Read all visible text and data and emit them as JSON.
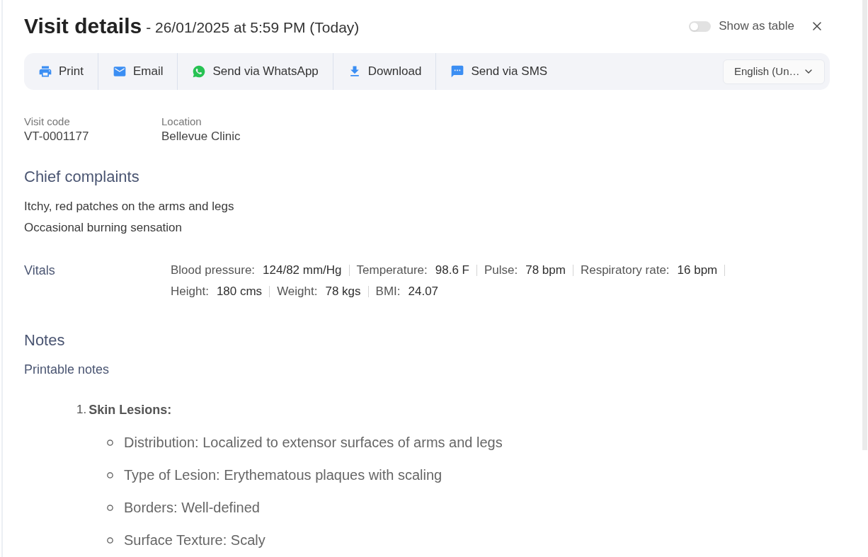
{
  "header": {
    "title": "Visit details",
    "subtitle": "- 26/01/2025 at 5:59 PM (Today)",
    "show_as_table": {
      "label": "Show as table",
      "on": false
    }
  },
  "toolbar": {
    "actions": [
      {
        "kind": "print",
        "label": "Print"
      },
      {
        "kind": "email",
        "label": "Email"
      },
      {
        "kind": "whatsapp",
        "label": "Send via WhatsApp"
      },
      {
        "kind": "download",
        "label": "Download"
      },
      {
        "kind": "sms",
        "label": "Send via SMS"
      }
    ],
    "language": {
      "value": "English (Un…"
    }
  },
  "info": [
    {
      "label": "Visit code",
      "value": "VT-0001177"
    },
    {
      "label": "Location",
      "value": "Bellevue Clinic"
    }
  ],
  "chief_complaints": {
    "title": "Chief complaints",
    "items": [
      "Itchy, red patches on the arms and legs",
      "Occasional burning sensation"
    ]
  },
  "vitals": {
    "title": "Vitals",
    "items": [
      {
        "label": "Blood pressure:",
        "value": "124/82 mm/Hg"
      },
      {
        "label": "Temperature:",
        "value": "98.6 F"
      },
      {
        "label": "Pulse:",
        "value": "78 bpm"
      },
      {
        "label": "Respiratory rate:",
        "value": "16 bpm"
      },
      {
        "label": "Height:",
        "value": "180 cms"
      },
      {
        "label": "Weight:",
        "value": "78 kgs"
      },
      {
        "label": "BMI:",
        "value": "24.07"
      }
    ]
  },
  "notes": {
    "title": "Notes",
    "subtitle": "Printable notes",
    "list": [
      {
        "number": "1.",
        "heading": "Skin Lesions:",
        "children": [
          {
            "text": "Distribution: Localized to extensor surfaces of arms and legs"
          },
          {
            "text": "Type of Lesion: Erythematous plaques with scaling"
          },
          {
            "text": "Borders: Well-defined"
          },
          {
            "text": "Surface Texture: Scaly"
          }
        ]
      }
    ]
  }
}
